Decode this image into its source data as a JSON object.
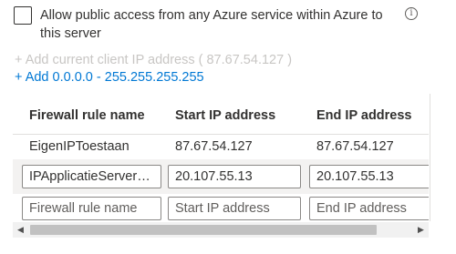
{
  "public_access": {
    "label": "Allow public access from any Azure service within Azure to this server",
    "checked": false,
    "info_icon": "info-icon"
  },
  "links": {
    "add_client_ip": "+ Add current client IP address ( 87.67.54.127 )",
    "add_all_range": "+ Add 0.0.0.0 - 255.255.255.255"
  },
  "table": {
    "headers": {
      "name": "Firewall rule name",
      "start": "Start IP address",
      "end": "End IP address"
    },
    "rows": [
      {
        "name": "EigenIPToestaan",
        "start": "87.67.54.127",
        "end": "87.67.54.127"
      }
    ],
    "edit_row": {
      "name": "IPApplicatieServerToegang",
      "start": "20.107.55.13",
      "end": "20.107.55.13"
    },
    "new_row": {
      "name_placeholder": "Firewall rule name",
      "start_placeholder": "Start IP address",
      "end_placeholder": "End IP address"
    }
  },
  "scrollbar": {
    "left_arrow": "◀",
    "right_arrow": "▶"
  }
}
